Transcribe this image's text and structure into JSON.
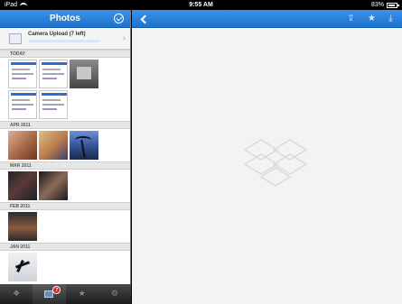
{
  "status_bar": {
    "device": "iPad",
    "time": "9:55 AM",
    "battery": "83%"
  },
  "sidebar": {
    "title": "Photos",
    "upload": {
      "label": "Camera Upload (7 left)",
      "progress": 0.0
    },
    "sections": [
      {
        "label": "TODAY",
        "photos": [
          "screenshot",
          "screenshot",
          "screenshot-grey",
          "screenshot",
          "screenshot"
        ]
      },
      {
        "label": "APR 2011",
        "photos": [
          "kids",
          "kids",
          "palm-tree"
        ]
      },
      {
        "label": "MAR 2011",
        "photos": [
          "people-dark",
          "people-dark"
        ]
      },
      {
        "label": "FEB 2011",
        "photos": [
          "child"
        ]
      },
      {
        "label": "JAN 2011",
        "photos": [
          "snow-angel"
        ]
      }
    ]
  },
  "tabbar": {
    "tabs": [
      {
        "name": "dropbox",
        "icon": "dropbox-icon"
      },
      {
        "name": "photos",
        "icon": "photos-icon",
        "badge": "7",
        "active": true
      },
      {
        "name": "favorites",
        "icon": "star-icon"
      },
      {
        "name": "settings",
        "icon": "gear-icon"
      }
    ]
  },
  "viewer": {
    "toolbar_icons": [
      "back-icon",
      "share-icon",
      "star-icon",
      "download-icon"
    ],
    "placeholder": "dropbox-logo-watermark"
  },
  "colors": {
    "header_blue": "#1d73cf",
    "badge_red": "#d6231e"
  }
}
